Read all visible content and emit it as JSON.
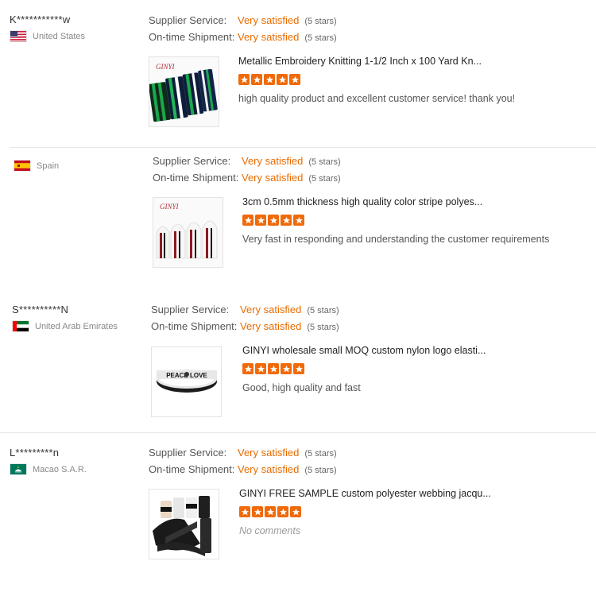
{
  "labels": {
    "supplier_service": "Supplier Service:",
    "ontime_shipment": "On-time Shipment:"
  },
  "reviews": [
    {
      "buyer": "K***********w",
      "country": "United States",
      "supplier_rating": "Very satisfied",
      "supplier_stars": "(5 stars)",
      "shipment_rating": "Very satisfied",
      "shipment_stars": "(5 stars)",
      "product_title": "Metallic Embroidery Knitting 1-1/2 Inch x 100 Yard Kn...",
      "star_count": 5,
      "comment": "high quality product and excellent customer service! thank you!"
    },
    {
      "buyer": "",
      "country": "Spain",
      "supplier_rating": "Very satisfied",
      "supplier_stars": "(5 stars)",
      "shipment_rating": "Very satisfied",
      "shipment_stars": "(5 stars)",
      "product_title": "3cm 0.5mm thickness high quality color stripe polyes...",
      "star_count": 5,
      "comment": "Very fast in responding and understanding the customer requirements"
    },
    {
      "buyer": "S**********N",
      "country": "United Arab Emirates",
      "supplier_rating": "Very satisfied",
      "supplier_stars": "(5 stars)",
      "shipment_rating": "Very satisfied",
      "shipment_stars": "(5 stars)",
      "product_title": "GINYI wholesale small MOQ custom nylon logo elasti...",
      "star_count": 5,
      "comment": "Good, high quality and fast"
    },
    {
      "buyer": "L*********n",
      "country": "Macao S.A.R.",
      "supplier_rating": "Very satisfied",
      "supplier_stars": "(5 stars)",
      "shipment_rating": "Very satisfied",
      "shipment_stars": "(5 stars)",
      "product_title": "GINYI FREE SAMPLE custom polyester webbing jacqu...",
      "star_count": 5,
      "comment": "No comments"
    }
  ],
  "thumbnail_text": {
    "brand": "GINYI",
    "band3": "PEACE LOVE"
  },
  "colors": {
    "accent": "#e86c00",
    "star": "#f06a0a"
  }
}
